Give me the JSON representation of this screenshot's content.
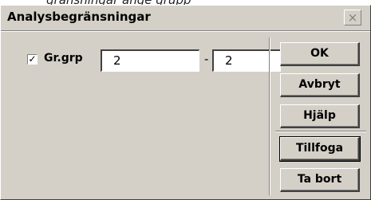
{
  "window": {
    "title": "Analysbegränsningar",
    "close_symbol": "×"
  },
  "caption": {
    "text": "gränsningar ange grupp"
  },
  "filter": {
    "checked": true,
    "check_mark": "✓",
    "label": "Gr.grp",
    "from_value": "2",
    "separator": "-",
    "to_value": "2"
  },
  "buttons": {
    "ok": "OK",
    "cancel": "Avbryt",
    "help": "Hjälp",
    "add": "Tillfoga",
    "remove": "Ta bort"
  }
}
